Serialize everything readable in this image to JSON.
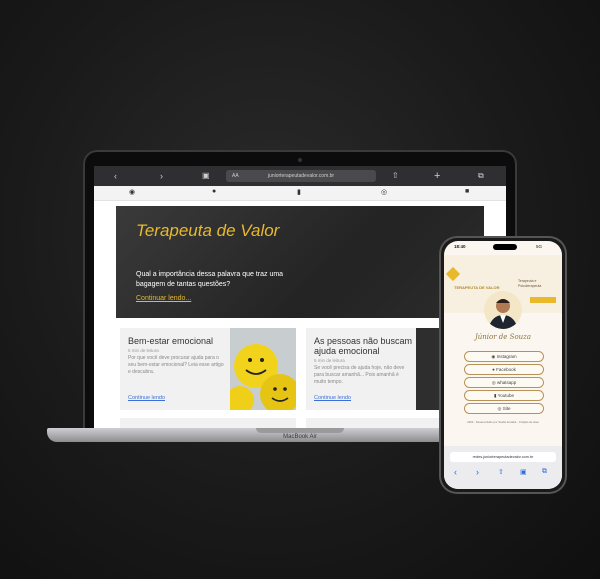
{
  "laptop": {
    "browser": {
      "back_icon": "chevron-left-icon",
      "forward_icon": "chevron-right-icon",
      "reader": "AA",
      "url": "juniorterapeutadevalor.com.br"
    },
    "socials": [
      "instagram-icon",
      "facebook-icon",
      "youtube-icon",
      "whatsapp-icon",
      "apple-icon"
    ],
    "hero": {
      "title": "Terapeuta de Valor",
      "subtitle": "Qual a importância dessa palavra que traz uma bagagem de tantas questões?",
      "link": "Continuar lendo..."
    },
    "cards": [
      {
        "title": "Bem-estar emocional",
        "meta": "5 min de leitura",
        "text": "Por que você deve procurar ajuda para o seu bem-estar emocional? Leia esse artigo e descubra.",
        "link": "Continue lendo"
      },
      {
        "title": "As pessoas não buscam ajuda emocional",
        "meta": "5 min de leitura",
        "text": "Se você precisa de ajuda hoje, não deve para buscar amanhã... Pois amanhã é muito tempo.",
        "link": "Continue lendo"
      }
    ],
    "brand": "MacBook Air"
  },
  "phone": {
    "time": "18:40",
    "signal": "5G",
    "logo_text": "TERAPEUTA DE VALOR",
    "tagline": "Terapeuta e Psicoterapeuta",
    "name": "Júnior de Souza",
    "buttons": [
      "Instagram",
      "Facebook",
      "whatsapp",
      "Youtube",
      "Site"
    ],
    "footer": "2024 · Desenvolvido por Studio Arcadia · Criação de sites",
    "url": "redes.juniorterapeutadevalor.com.br",
    "accent": "#e8b92a"
  }
}
